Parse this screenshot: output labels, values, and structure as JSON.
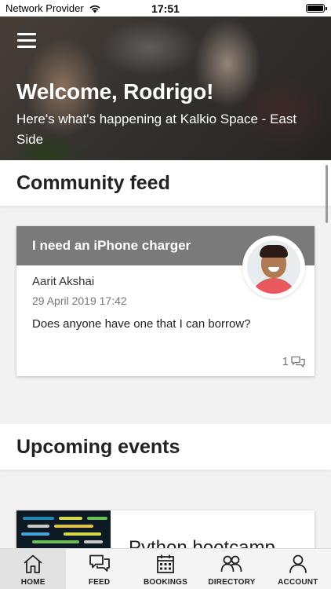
{
  "status_bar": {
    "carrier": "Network Provider",
    "time": "17:51",
    "battery_level": 1.0
  },
  "hero": {
    "menu_icon": "hamburger-icon",
    "title": "Welcome, Rodrigo!",
    "subtitle": "Here's what's happening at Kalkio Space - East Side"
  },
  "community_feed": {
    "heading": "Community feed",
    "post": {
      "title": "I need an iPhone charger",
      "author": "Aarit Akshai",
      "date": "29 April 2019 17:42",
      "body": "Does anyone have one that I can borrow?",
      "comment_count": "1",
      "comment_icon": "comments-icon"
    }
  },
  "upcoming_events": {
    "heading": "Upcoming events",
    "event": {
      "title": "Python bootcamp"
    }
  },
  "tab_bar": {
    "tabs": [
      {
        "label": "HOME",
        "icon": "home-icon",
        "active": true
      },
      {
        "label": "FEED",
        "icon": "chat-icon",
        "active": false
      },
      {
        "label": "BOOKINGS",
        "icon": "calendar-icon",
        "active": false
      },
      {
        "label": "DIRECTORY",
        "icon": "people-icon",
        "active": false
      },
      {
        "label": "ACCOUNT",
        "icon": "user-icon",
        "active": false
      }
    ]
  }
}
